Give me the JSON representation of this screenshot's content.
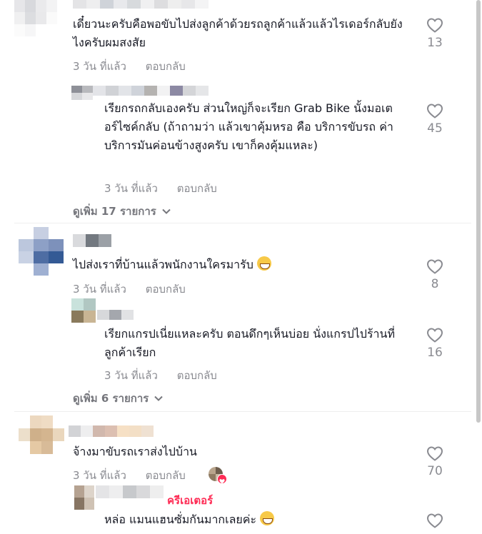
{
  "comments": [
    {
      "id": "c1",
      "text": "เดี๋ยวนะครับคือพอขับไปส่งลูกค้าด้วยรถลูกค้าแล้วแล้วไรเดอร์กลับยังไงครับผมสงสัย",
      "time": "3 วัน ที่แล้ว",
      "reply": "ตอบกลับ",
      "likes": "13",
      "replies": [
        {
          "text": "เรียกรถกลับเองครับ ส่วนใหญ่ก็จะเรียก Grab Bike นั้งมอเตอร์ไซค์กลับ (ถ้าถามว่า แล้วเขาคุ้มหรอ คือ บริการขับรถ ค่าบริการมันค่อนข้างสูงครับ เขาก็คงคุ้มแหละ)",
          "time": "3 วัน ที่แล้ว",
          "reply": "ตอบกลับ",
          "likes": "45"
        }
      ],
      "view_more": "ดูเพิ่ม 17 รายการ"
    },
    {
      "id": "c2",
      "text": "ไปส่งเราที่บ้านแล้วพนักงานใครมารับ",
      "emoji": "laughing-emoji",
      "time": "3 วัน ที่แล้ว",
      "reply": "ตอบกลับ",
      "likes": "8",
      "replies": [
        {
          "text": "เรียกแกรปเนี่ยแหละครับ ตอนดึกๆเห็นบ่อย นั่งแกรปไปร้านที่ลูกค้าเรียก",
          "time": "3 วัน ที่แล้ว",
          "reply": "ตอบกลับ",
          "likes": "16"
        }
      ],
      "view_more": "ดูเพิ่ม 6 รายการ"
    },
    {
      "id": "c3",
      "text": "จ้างมาขับรถเราส่งไปบ้าน",
      "time": "3 วัน ที่แล้ว",
      "reply": "ตอบกลับ",
      "likes": "70",
      "creator_liked": true,
      "replies": [
        {
          "creator_badge": "ครีเอเตอร์",
          "text": "หล่อ แมนแฮนซั่มกันมากเลยค่ะ",
          "emoji": "grinning-emoji"
        }
      ]
    }
  ],
  "colors": {
    "text": "#161823",
    "meta": "#8a8b91",
    "accent": "#fe2c55"
  }
}
